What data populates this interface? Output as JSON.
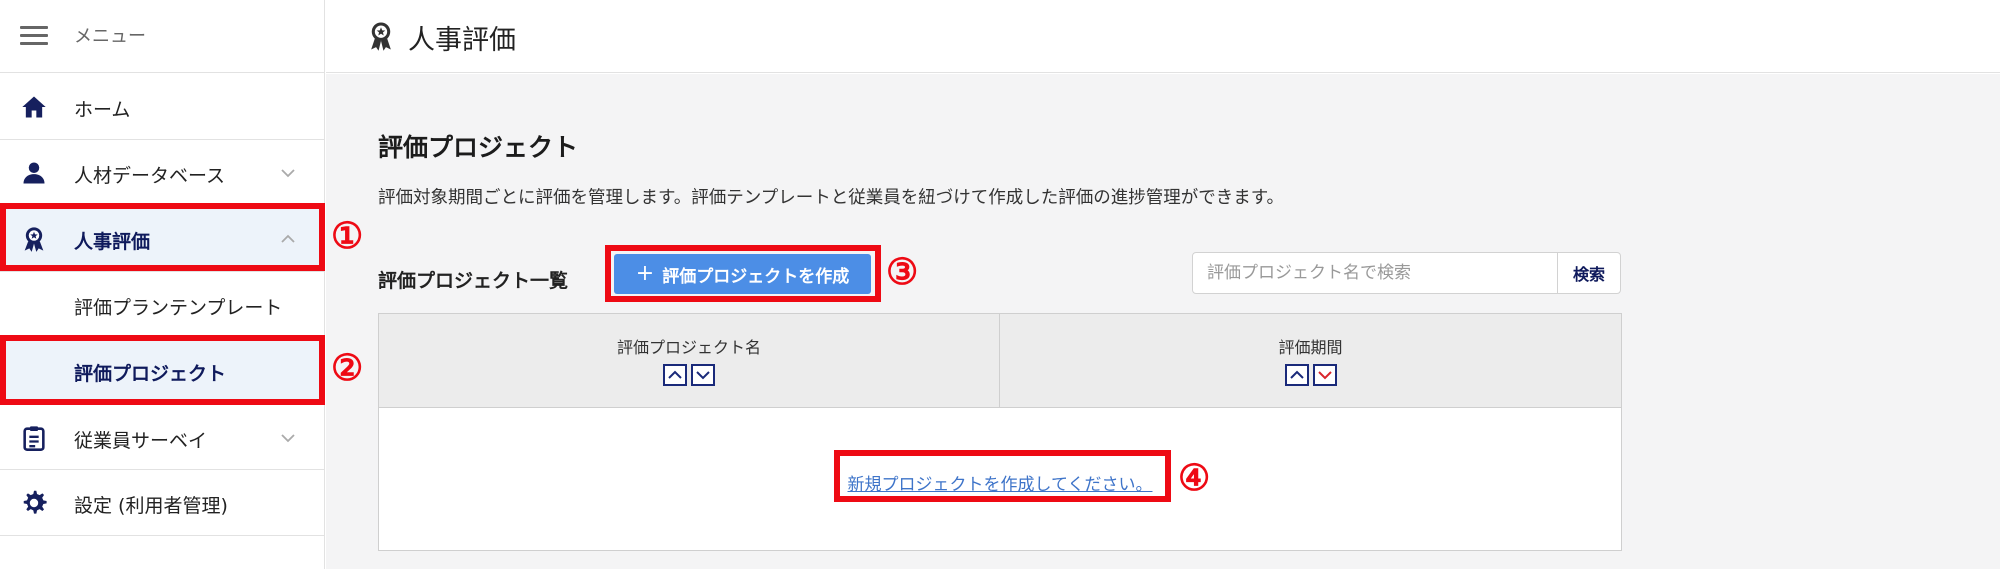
{
  "sidebar": {
    "menu_label": "メニュー",
    "items": [
      {
        "label": "ホーム",
        "icon": "home-icon"
      },
      {
        "label": "人材データベース",
        "icon": "person-icon"
      },
      {
        "label": "人事評価",
        "icon": "award-icon"
      },
      {
        "label": "評価プランテンプレート"
      },
      {
        "label": "評価プロジェクト"
      },
      {
        "label": "従業員サーベイ",
        "icon": "clipboard-icon"
      },
      {
        "label": "設定 (利用者管理)",
        "icon": "gear-icon"
      }
    ]
  },
  "header": {
    "title": "人事評価",
    "icon": "award-icon"
  },
  "main": {
    "section_title": "評価プロジェクト",
    "description": "評価対象期間ごとに評価を管理します。評価テンプレートと従業員を紐づけて作成した評価の進捗管理ができます。",
    "list_label": "評価プロジェクト一覧",
    "create_button": "評価プロジェクトを作成",
    "search": {
      "placeholder": "評価プロジェクト名で検索",
      "button": "検索"
    },
    "table": {
      "columns": [
        "評価プロジェクト名",
        "評価期間"
      ],
      "empty_link": "新規プロジェクトを作成してください。"
    }
  },
  "annotations": [
    "①",
    "②",
    "③",
    "④"
  ],
  "colors": {
    "accent": "#4c8ee6",
    "navy": "#0f1a5c",
    "highlight": "#ee0a14",
    "active_bg": "#edf3fa"
  }
}
